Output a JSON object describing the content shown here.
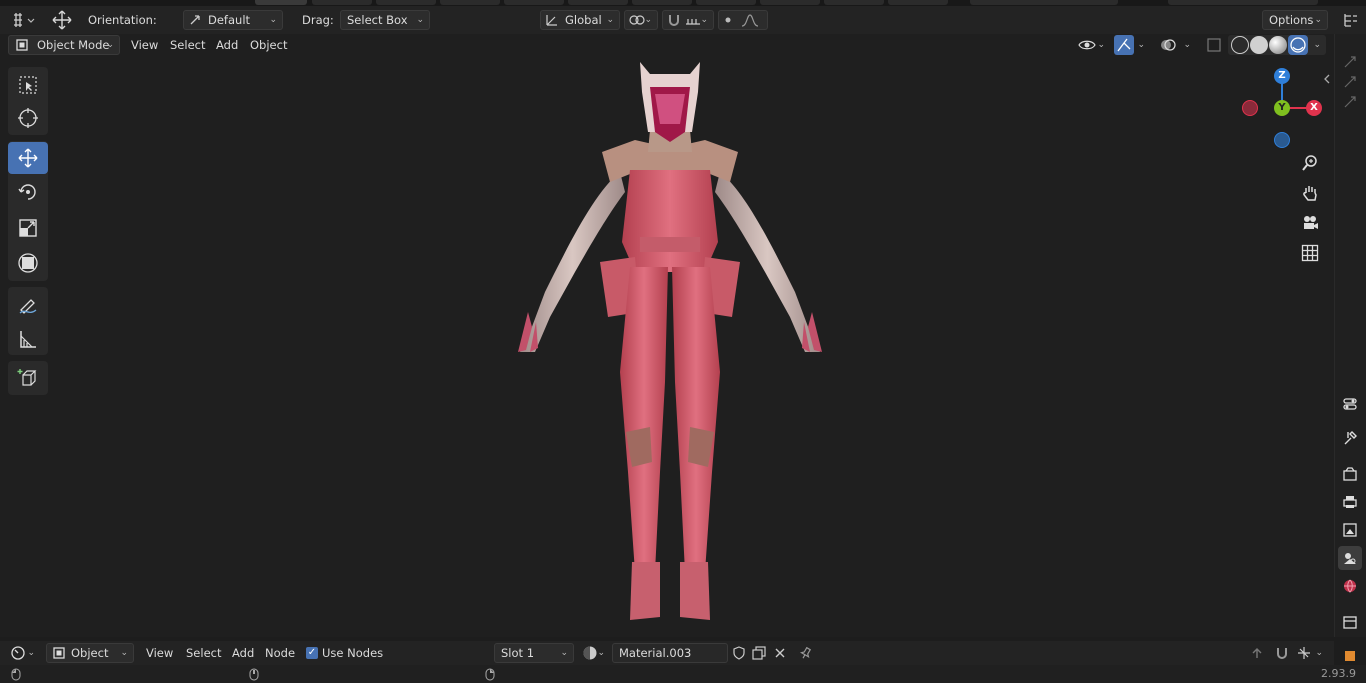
{
  "top_header": {
    "orientation_label": "Orientation:",
    "orientation_value": "Default",
    "drag_label": "Drag:",
    "drag_value": "Select Box",
    "transform_orientation": "Global",
    "options_label": "Options"
  },
  "viewport_header": {
    "mode": "Object Mode",
    "menus": [
      "View",
      "Select",
      "Add",
      "Object"
    ]
  },
  "gizmo": {
    "z": "Z",
    "y": "Y",
    "x": "X",
    "colors": {
      "x": "#e0334d",
      "y": "#7fbf1f",
      "z": "#2f7fd9"
    }
  },
  "shader_header": {
    "editor_type": "Object",
    "menus": [
      "View",
      "Select",
      "Add",
      "Node"
    ],
    "use_nodes_label": "Use Nodes",
    "use_nodes_checked": true,
    "slot": "Slot 1",
    "material_name": "Material.003"
  },
  "status": {
    "version": "2.93.9"
  },
  "colors": {
    "accent": "#4772b3",
    "background": "#1d1d1d"
  }
}
